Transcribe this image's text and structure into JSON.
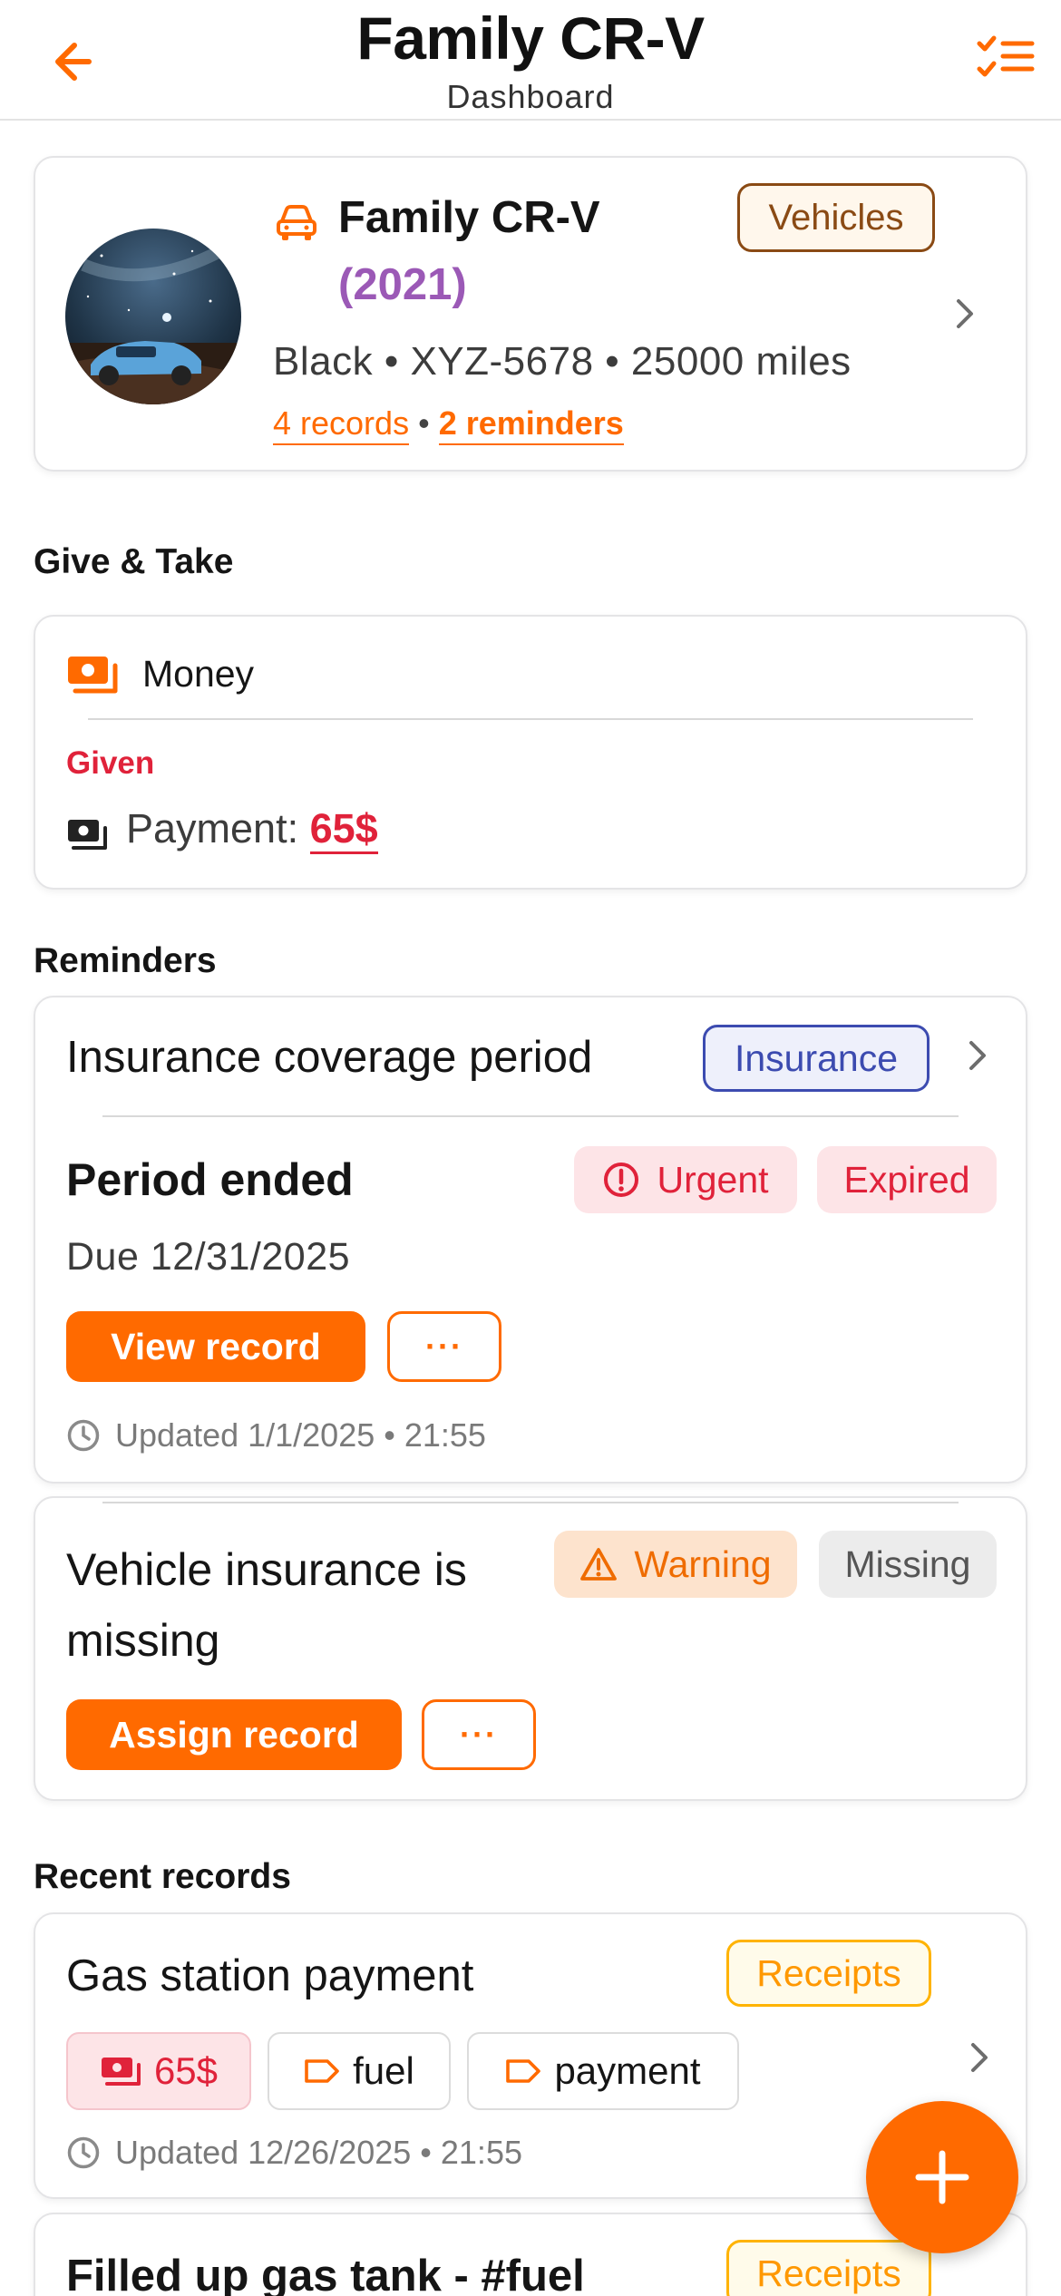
{
  "header": {
    "title": "Family CR-V",
    "subtitle": "Dashboard",
    "back_icon": "arrow-left-icon",
    "action_icon": "checklist-icon"
  },
  "vehicle": {
    "name": "Family CR-V",
    "year": "(2021)",
    "badge": "Vehicles",
    "meta": "Black • XYZ-5678 • 25000 miles",
    "records_link": "4 records",
    "separator": "•",
    "reminders_link": "2 reminders"
  },
  "give_take": {
    "section_title": "Give & Take",
    "card_title": "Money",
    "direction": "Given",
    "payment_label": "Payment: ",
    "payment_amount": "65$"
  },
  "reminders": {
    "section_title": "Reminders",
    "items": [
      {
        "title": "Insurance coverage period",
        "category": "Insurance",
        "status_title": "Period ended",
        "priority": "Urgent",
        "state": "Expired",
        "due": "Due 12/31/2025",
        "action": "View record",
        "more": "···",
        "updated": "Updated 1/1/2025 • 21:55"
      },
      {
        "status_title": "Vehicle insurance is missing",
        "priority": "Warning",
        "state": "Missing",
        "action": "Assign record",
        "more": "···"
      }
    ]
  },
  "recent_records": {
    "section_title": "Recent records",
    "items": [
      {
        "title": "Gas station payment",
        "category": "Receipts",
        "amount": "65$",
        "tags": [
          "fuel",
          "payment"
        ],
        "updated": "Updated 12/26/2025 • 21:55"
      },
      {
        "title": "Filled up gas tank - #fuel",
        "category": "Receipts"
      }
    ]
  },
  "colors": {
    "accent": "#ff6a00",
    "danger": "#e0223a",
    "year": "#9b59b6",
    "insurance": "#3c4bb0"
  }
}
